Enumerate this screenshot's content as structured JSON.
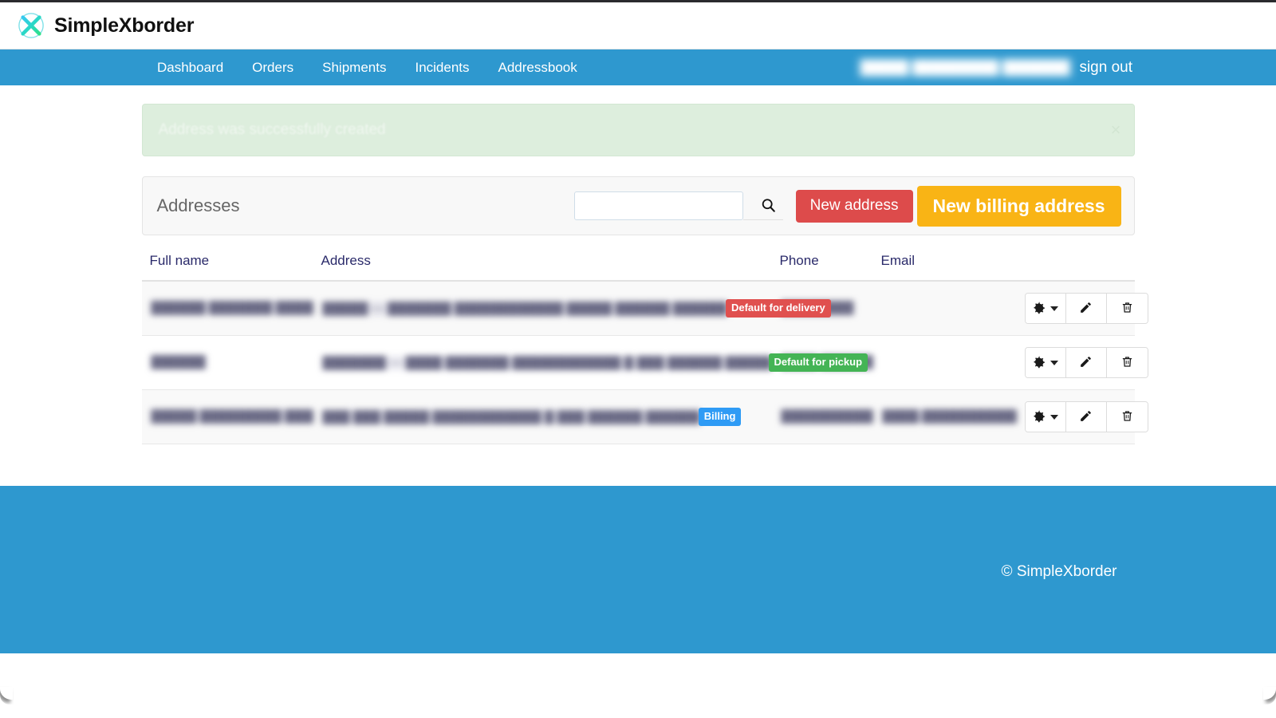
{
  "brand": {
    "name": "SimpleXborder",
    "logo_icon": "x-circle-logo-icon"
  },
  "nav": {
    "items": [
      {
        "label": "Dashboard"
      },
      {
        "label": "Orders"
      },
      {
        "label": "Shipments"
      },
      {
        "label": "Incidents"
      },
      {
        "label": "Addressbook"
      }
    ],
    "user_name": "█████ █████████ ███████",
    "sign_out_label": "sign out"
  },
  "alert": {
    "message": "Address was successfully created",
    "close_label": "×",
    "type": "success",
    "background": "#ddeedd"
  },
  "panel": {
    "title": "Addresses",
    "search": {
      "value": "",
      "placeholder": "",
      "icon": "search-icon"
    },
    "new_address_label": "New address",
    "new_address_color": "#dd4b4b",
    "new_billing_label": "New billing address",
    "new_billing_color": "#f9b415"
  },
  "table": {
    "columns": [
      {
        "key": "full_name",
        "label": "Full name"
      },
      {
        "key": "address",
        "label": "Address"
      },
      {
        "key": "phone",
        "label": "Phone"
      },
      {
        "key": "email",
        "label": "Email"
      }
    ],
    "rows": [
      {
        "full_name": "██████ ███████ ███████",
        "address": "█████ — ███████ ████████████ █████  ██████ ██████",
        "badge": {
          "label": "Default for delivery",
          "color": "#e0504f",
          "style": "badge-delivery"
        },
        "phone": "████████",
        "email": "",
        "row_style": "odd"
      },
      {
        "full_name": "██████",
        "address": "███████ — ████ ███████ ████████████ █ ███  ██████ ██████",
        "badge": {
          "label": "Default for pickup",
          "color": "#44b455",
          "style": "badge-pickup"
        },
        "phone": "████ ██████",
        "email": "",
        "row_style": "even"
      },
      {
        "full_name": "█████ █████████ ███████",
        "address": "███  ███ █████ ████████████ █ ███  ██████ ██████",
        "badge": {
          "label": "Billing",
          "color": "#2f9bf5",
          "style": "badge-billing"
        },
        "phone": "███████████",
        "email": "████.████████████.███",
        "row_style": "odd"
      }
    ],
    "row_actions": {
      "settings_icon": "gear-icon",
      "edit_icon": "pencil-icon",
      "delete_icon": "trash-icon"
    }
  },
  "footer": {
    "copyright": "© SimpleXborder",
    "background": "#2e98cf"
  }
}
